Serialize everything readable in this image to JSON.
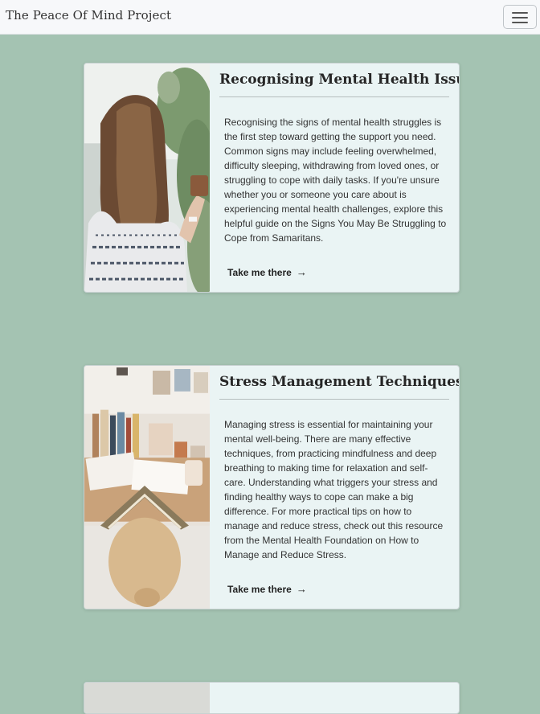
{
  "navbar": {
    "brand": "The Peace Of Mind Project",
    "menu_icon": "hamburger-menu-icon"
  },
  "cards": [
    {
      "title": "Recognising Mental Health Issues",
      "text": "Recognising the signs of mental health struggles is the first step toward getting the support you need. Common signs may include feeling overwhelmed, difficulty sleeping, withdrawing from loved ones, or struggling to cope with daily tasks. If you're unsure whether you or someone you care about is experiencing mental health challenges, explore this helpful guide on the Signs You May Be Struggling to Cope from Samaritans.",
      "link_label": "Take me there",
      "link_icon": "arrow-right-icon",
      "image": "woman-with-long-hair-holding-coffee-cup"
    },
    {
      "title": "Stress Management Techniques",
      "text": "Managing stress is essential for maintaining your mental well-being. There are many effective techniques, from practicing mindfulness and deep breathing to making time for relaxation and self-care. Understanding what triggers your stress and finding healthy ways to cope can make a big difference. For more practical tips on how to manage and reduce stress, check out this resource from the Mental Health Foundation on How to Manage and Reduce Stress.",
      "link_label": "Take me there",
      "link_icon": "arrow-right-icon",
      "image": "person-with-open-book-on-head"
    }
  ],
  "colors": {
    "page_background": "#a4c3b2",
    "card_background": "#eaf4f4",
    "navbar_background": "#f7f8fa"
  }
}
